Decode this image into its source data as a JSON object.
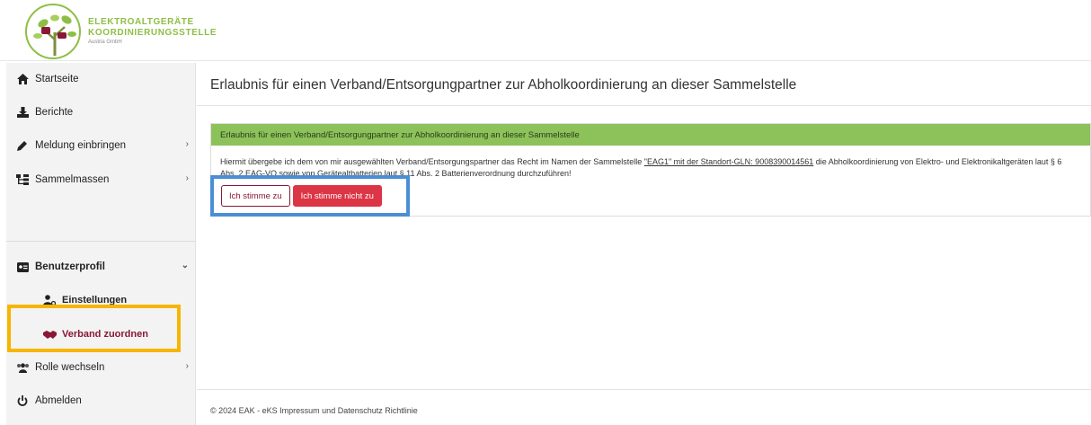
{
  "logo": {
    "line1": "ELEKTROALTGERÄTE",
    "line2": "KOORDINIERUNGSSTELLE",
    "line3": "Austria GmbH",
    "brand_color": "#8dbf45"
  },
  "sidebar": {
    "items": [
      {
        "label": "Startseite",
        "icon": "home-icon"
      },
      {
        "label": "Berichte",
        "icon": "download-icon"
      },
      {
        "label": "Meldung einbringen",
        "icon": "pen-icon"
      },
      {
        "label": "Sammelmassen",
        "icon": "sitemap-icon"
      }
    ],
    "profile": {
      "label": "Benutzerprofil",
      "icon": "id-card-icon"
    },
    "settings": {
      "label": "Einstellungen",
      "icon": "user-cog-icon"
    },
    "assign": {
      "label": "Verband zuordnen",
      "icon": "handshake-icon"
    },
    "switch_role": {
      "label": "Rolle wechseln",
      "icon": "users-icon"
    },
    "logout": {
      "label": "Abmelden",
      "icon": "power-icon"
    },
    "active_color": "#8a1736"
  },
  "main": {
    "title": "Erlaubnis für einen Verband/Entsorgungpartner zur Abholkoordinierung an dieser Sammelstelle",
    "card": {
      "header": "Erlaubnis für einen Verband/Entsorgungpartner zur Abholkoordinierung an dieser Sammelstelle",
      "text_before": "Hiermit übergebe ich dem von mir ausgewählten Verband/Entsorgungspartner das Recht im Namen der Sammelstelle ",
      "text_link": "\"EAG1\" mit der Standort-GLN: 9008390014561",
      "text_after": " die Abholkoordinierung von Elektro- und Elektronikaltgeräten laut § 6 Abs. 2 EAG-VO sowie von Gerätealtbatterien laut § 11 Abs. 2 Batterienverordnung durchzuführen!",
      "header_color": "#8dc15a"
    },
    "buttons": {
      "agree": "Ich stimme zu",
      "disagree": "Ich stimme nicht zu"
    }
  },
  "footer": {
    "text": "© 2024 EAK - eKS Impressum und Datenschutz Richtlinie"
  },
  "highlights": {
    "yellow": "#f7b500",
    "blue": "#4a8ed6"
  }
}
